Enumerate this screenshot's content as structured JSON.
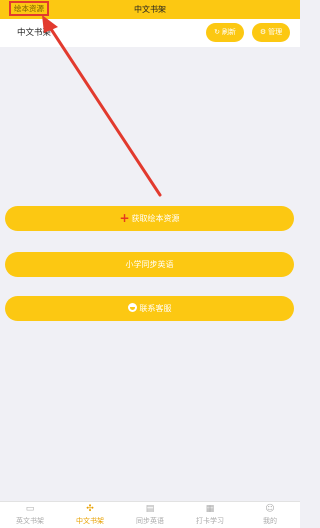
{
  "topbar": {
    "left_link": "绘本资源",
    "title": "中文书架"
  },
  "subheader": {
    "title": "中文书架",
    "refresh": {
      "label": "刷新",
      "icon": "refresh-icon"
    },
    "manage": {
      "label": "管理",
      "icon": "gear-icon"
    }
  },
  "actions": {
    "get_resources": {
      "label": "获取绘本资源",
      "icon": "plus-icon"
    },
    "sync_english": {
      "label": "小学同步英语"
    },
    "contact_service": {
      "label": "联系客服",
      "icon": "chat-icon"
    }
  },
  "tabbar": {
    "tabs": [
      {
        "label": "英文书架",
        "icon": "book-icon"
      },
      {
        "label": "中文书架",
        "icon": "grid-icon",
        "active": true
      },
      {
        "label": "同步英语",
        "icon": "clipboard-icon"
      },
      {
        "label": "打卡学习",
        "icon": "apps-icon"
      },
      {
        "label": "我的",
        "icon": "person-icon"
      }
    ]
  },
  "colors": {
    "accent": "#fcc812",
    "annotation": "#e23a2e",
    "active_tab": "#e8a000"
  }
}
